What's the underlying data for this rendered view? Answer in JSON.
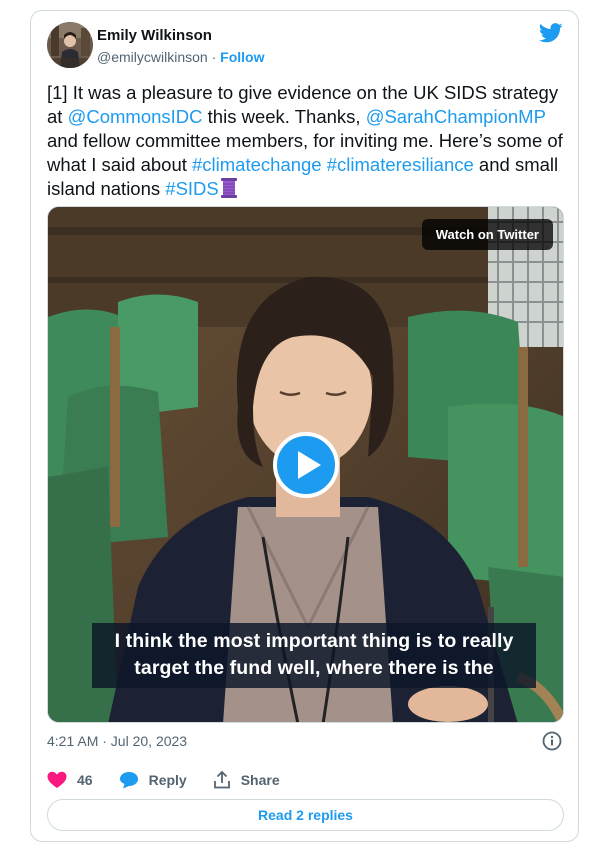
{
  "author": {
    "name": "Emily Wilkinson",
    "handle": "@emilycwilkinson",
    "separator": " · ",
    "follow_label": "Follow"
  },
  "tweet": {
    "p1": "[1] It was a pleasure to give evidence on the UK SIDS strategy at ",
    "m1": "@CommonsIDC",
    "p2": " this week. Thanks, ",
    "m2": "@SarahChampionMP",
    "p3": " and fellow committee members, for inviting me. Here’s some of what I said about ",
    "h1": "#climatechange",
    "p4": " ",
    "h2": "#climateresiliance",
    "p5": " and small island nations ",
    "h3": "#SIDS"
  },
  "media": {
    "watch_label": "Watch on Twitter",
    "caption_line1": "I think the most important thing is to really",
    "caption_line2": "target the fund well, where there is the"
  },
  "meta": {
    "timestamp": "4:21 AM · Jul 20, 2023"
  },
  "actions": {
    "like_count": "46",
    "reply_label": "Reply",
    "share_label": "Share"
  },
  "footer": {
    "read_replies": "Read 2 replies"
  },
  "colors": {
    "accent": "#1d9bf0",
    "like": "#f91880",
    "muted": "#536471",
    "border": "#cfd9de"
  }
}
